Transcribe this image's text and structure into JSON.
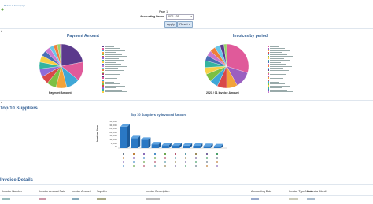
{
  "page": {
    "return_link": "Return to homepage",
    "page_label": "Page 1",
    "period_label": "Accounting Period",
    "period_value": "2021 / 01",
    "apply_label": "Apply",
    "reset_label": "Reset"
  },
  "panels": {
    "payment": {
      "title": "Payment Amount",
      "footer": "Payment Amount"
    },
    "invoices": {
      "title": "Invoices by period",
      "footer": "2021 / 01 Invoice Amount"
    }
  },
  "top_suppliers": {
    "section_title": "Top 10 Suppliers",
    "chart_title": "Top 10 Suppliers by Invoiced Amount",
    "ylabel": "Invoiced Amo..."
  },
  "invoice_details": {
    "section_title": "Invoice Details",
    "columns": [
      "Invoice Number",
      "Invoice Amount Paid",
      "Invoice Amount",
      "Supplier",
      "Invoice Description",
      "Accounting Date",
      "Invoice Type Name",
      "Calendar Month"
    ]
  },
  "colors": {
    "accent": "#2f5d93",
    "bar": "#2a78c4",
    "pie_payment": [
      "#5b3a8c",
      "#e05a9a",
      "#3fa7d6",
      "#f2a33a",
      "#7bc043",
      "#d94848",
      "#8e6bd8",
      "#34b3a0",
      "#f7d046",
      "#4a6fb5",
      "#c978d0",
      "#69c7e8",
      "#ef7f3a",
      "#9ad36a",
      "#b03a6f"
    ],
    "pie_invoice": [
      "#e05a9a",
      "#9b5fc0",
      "#f2a33a",
      "#d94848",
      "#3fa7d6",
      "#7bc043",
      "#f7d046",
      "#34b3a0",
      "#4a6fb5",
      "#c978d0",
      "#ef7f3a",
      "#69c7e8",
      "#5b3a8c",
      "#9ad36a"
    ]
  },
  "chart_data": [
    {
      "type": "pie",
      "title": "Payment Amount",
      "values": [
        22,
        14,
        10,
        8,
        7,
        6,
        6,
        5,
        5,
        4,
        4,
        3,
        3,
        2,
        1
      ]
    },
    {
      "type": "pie",
      "title": "Invoices by period",
      "values": [
        30,
        12,
        8,
        7,
        6,
        6,
        5,
        5,
        4,
        4,
        4,
        4,
        3,
        2
      ]
    },
    {
      "type": "bar",
      "title": "Top 10 Suppliers by Invoiced Amount",
      "ylabel": "Invoiced Amo...",
      "yticks": [
        "35,000K",
        "30,000K",
        "25,000K",
        "20,000K",
        "15,000K",
        "10,000K",
        "5,000K",
        "0K"
      ],
      "ylim": [
        0,
        35000
      ],
      "values": [
        28000,
        13000,
        11000,
        5000,
        3800,
        3500,
        3300,
        3100,
        2800,
        2500
      ]
    }
  ]
}
